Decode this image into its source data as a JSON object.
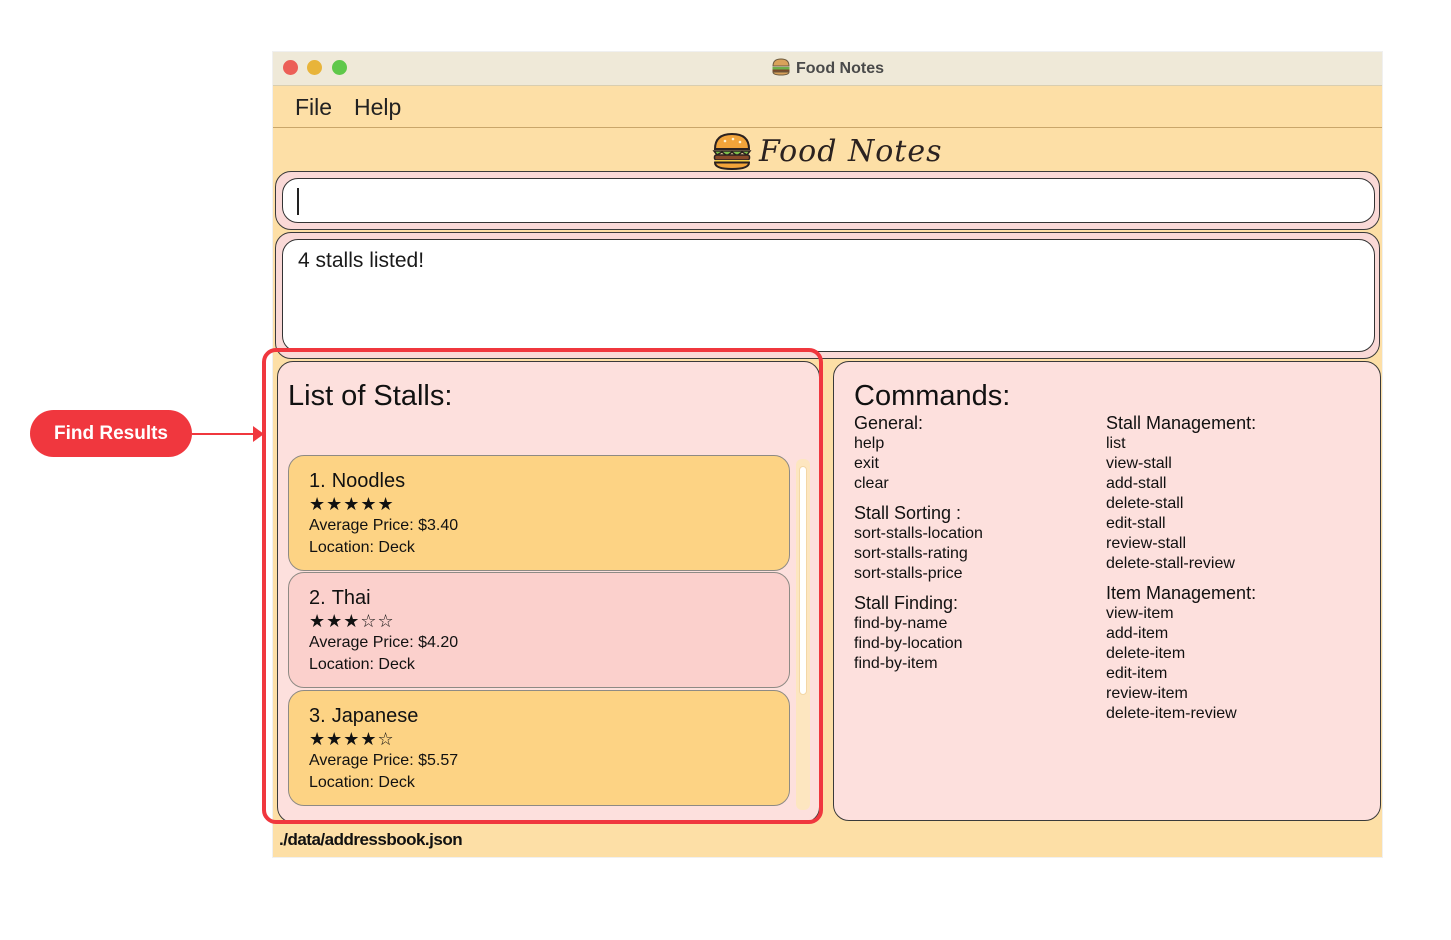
{
  "window": {
    "title": "Food Notes",
    "menu": [
      {
        "label": "File"
      },
      {
        "label": "Help"
      }
    ],
    "logo_text": "Food Notes"
  },
  "command_box": {
    "value": "",
    "placeholder": ""
  },
  "result_box": {
    "text": "4 stalls listed!"
  },
  "stalls_panel": {
    "title": "List of Stalls:",
    "stalls": [
      {
        "index": "1.",
        "name": "Noodles",
        "stars": "★★★★★",
        "rating": 5,
        "price": "Average Price: $3.40",
        "location": "Location: Deck"
      },
      {
        "index": "2.",
        "name": "Thai",
        "stars": "★★★☆☆",
        "rating": 3,
        "price": "Average Price: $4.20",
        "location": "Location: Deck"
      },
      {
        "index": "3.",
        "name": "Japanese",
        "stars": "★★★★☆",
        "rating": 4,
        "price": "Average Price: $5.57",
        "location": "Location: Deck"
      }
    ]
  },
  "commands_panel": {
    "title": "Commands:",
    "general": {
      "heading": "General:",
      "items": [
        "help",
        "exit",
        "clear"
      ]
    },
    "sorting": {
      "heading": "Stall Sorting :",
      "items": [
        "sort-stalls-location",
        "sort-stalls-rating",
        "sort-stalls-price"
      ]
    },
    "finding": {
      "heading": "Stall Finding:",
      "items": [
        "find-by-name",
        "find-by-location",
        "find-by-item"
      ]
    },
    "stall_management": {
      "heading": "Stall Management:",
      "items": [
        "list",
        "view-stall",
        "add-stall",
        "delete-stall",
        "edit-stall",
        "review-stall",
        "delete-stall-review"
      ]
    },
    "item_management": {
      "heading": "Item Management:",
      "items": [
        "view-item",
        "add-item",
        "delete-item",
        "edit-item",
        "review-item",
        "delete-item-review"
      ]
    }
  },
  "status_bar": {
    "path": "./data/addressbook.json"
  },
  "annotation": {
    "label": "Find Results",
    "color": "#f0373e"
  },
  "colors": {
    "window_bg": "#fddfa6",
    "panel_bg": "#fde0dd",
    "card_orange": "#fdd384",
    "card_pink": "#fbd0cc"
  }
}
